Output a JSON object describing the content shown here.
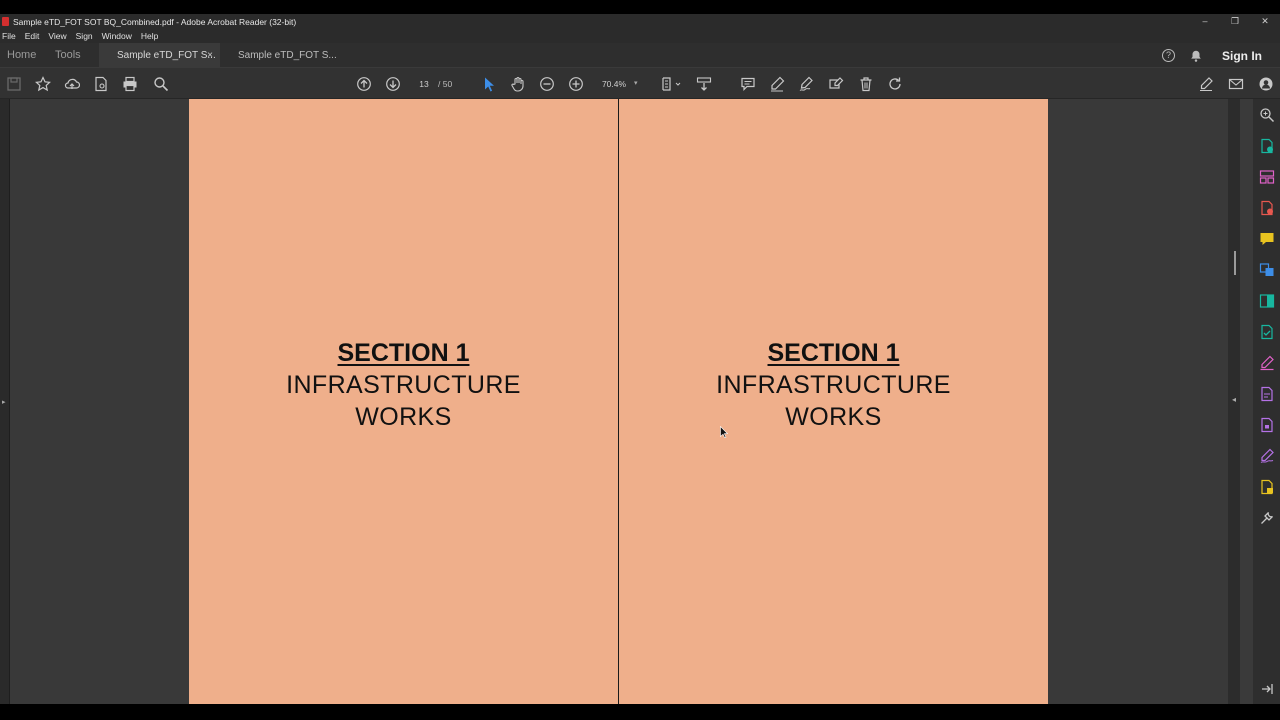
{
  "window": {
    "title": "Sample eTD_FOT SOT BQ_Combined.pdf - Adobe Acrobat Reader (32-bit)",
    "controls": {
      "minimize": "–",
      "maximize": "❐",
      "close": "✕"
    }
  },
  "menu": [
    "File",
    "Edit",
    "View",
    "Sign",
    "Window",
    "Help"
  ],
  "tabs": {
    "home": "Home",
    "tools": "Tools",
    "documents": [
      {
        "label": "Sample eTD_FOT S...",
        "active": true,
        "close": "×"
      },
      {
        "label": "Sample eTD_FOT S...",
        "active": false
      }
    ],
    "help": "?",
    "sign_in": "Sign In"
  },
  "toolbar": {
    "current_page": "13",
    "total_pages": "/ 50",
    "zoom": "70.4%",
    "zoom_caret": "▾"
  },
  "document": {
    "pages": [
      {
        "heading": "SECTION 1",
        "line1": "INFRASTRUCTURE",
        "line2": "WORKS"
      },
      {
        "heading": "SECTION 1",
        "line1": "INFRASTRUCTURE",
        "line2": "WORKS"
      }
    ],
    "page_color": "#efaf8b"
  },
  "side_panel": {
    "left_expand": "▸",
    "right_collapse": "◂"
  },
  "colors": {
    "accent_blue": "#3d8ee8",
    "tool_teal": "#18b7a0",
    "tool_pink": "#e062c8",
    "tool_yellow": "#e8c320",
    "tool_red": "#e8584f",
    "tool_purple": "#b572e6"
  }
}
